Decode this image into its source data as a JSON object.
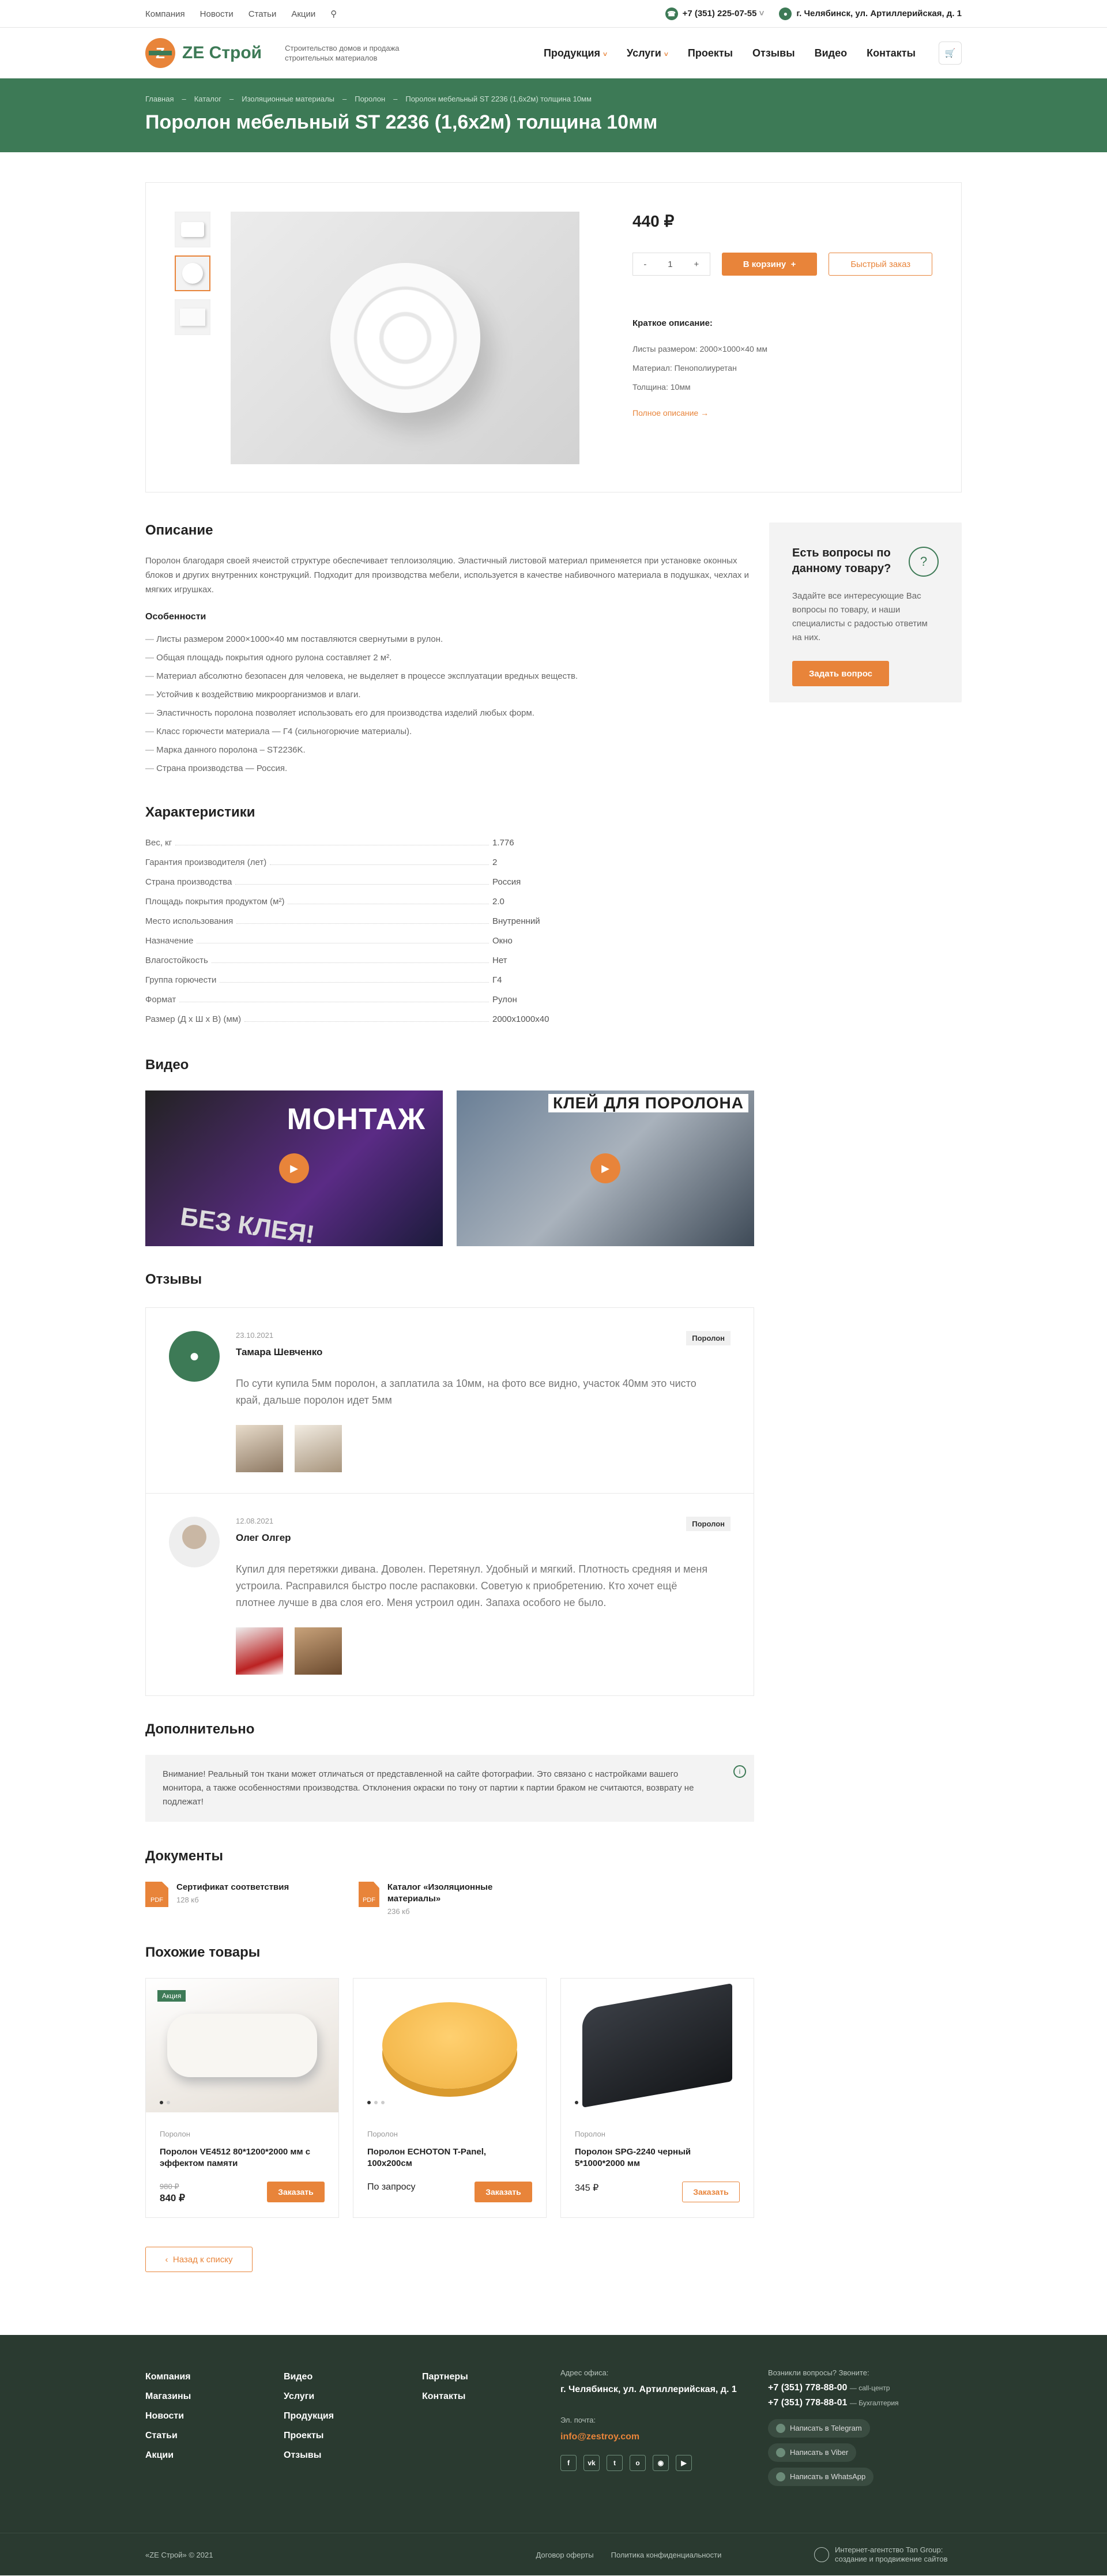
{
  "topbar": {
    "links": [
      "Компания",
      "Новости",
      "Статьи",
      "Акции"
    ],
    "phone": "+7 (351) 225-07-55",
    "address": "г. Челябинск, ул. Артиллерийская, д. 1"
  },
  "header": {
    "logo_text": "ZE Строй",
    "tagline": "Строительство домов и продажа строительных материалов",
    "nav": [
      "Продукция",
      "Услуги",
      "Проекты",
      "Отзывы",
      "Видео",
      "Контакты"
    ]
  },
  "hero": {
    "crumbs": [
      "Главная",
      "Каталог",
      "Изоляционные материалы",
      "Поролон",
      "Поролон мебельный ST 2236 (1,6х2м) толщина 10мм"
    ],
    "title": "Поролон мебельный ST 2236 (1,6х2м) толщина 10мм"
  },
  "product": {
    "price": "440 ₽",
    "qty": "1",
    "cart_btn": "В корзину",
    "quick_btn": "Быстрый заказ",
    "short_title": "Краткое описание:",
    "short_items": [
      "Листы размером: 2000×1000×40 мм",
      "Материал: Пенополиуретан",
      "Толщина: 10мм"
    ],
    "more_link": "Полное описание"
  },
  "description": {
    "title": "Описание",
    "text": "Поролон благодаря своей ячеистой структуре обеспечивает теплоизоляцию. Эластичный листовой материал применяется при установке оконных блоков и других внутренних конструкций. Подходит для производства мебели, используется в качестве набивочного материала в подушках, чехлах и мягких игрушках.",
    "features_title": "Особенности",
    "features": [
      "Листы размером 2000×1000×40 мм поставляются свернутыми в рулон.",
      "Общая площадь покрытия одного рулона составляет 2 м².",
      "Материал абсолютно безопасен для человека, не выделяет в процессе эксплуатации вредных веществ.",
      "Устойчив к воздействию микроорганизмов и влаги.",
      "Эластичность поролона позволяет использовать его для производства изделий любых форм.",
      "Класс горючести материала — Г4 (сильногорючие материалы).",
      "Марка данного поролона – ST2236K.",
      "Страна производства — Россия."
    ]
  },
  "question": {
    "title": "Есть вопросы по данному товару?",
    "text": "Задайте все интересующие Вас вопросы по товару, и наши специалисты с радостью ответим на них.",
    "button": "Задать вопрос"
  },
  "chars": {
    "title": "Характеристики",
    "rows": [
      [
        "Вес, кг",
        "1.776"
      ],
      [
        "Гарантия производителя (лет)",
        "2"
      ],
      [
        "Страна производства",
        "Россия"
      ],
      [
        "Площадь покрытия продуктом (м²)",
        "2.0"
      ],
      [
        "Место использования",
        "Внутренний"
      ],
      [
        "Назначение",
        "Окно"
      ],
      [
        "Влагостойкость",
        "Нет"
      ],
      [
        "Группа горючести",
        "Г4"
      ],
      [
        "Формат",
        "Рулон"
      ],
      [
        "Размер (Д х Ш х В) (мм)",
        "2000х1000х40"
      ]
    ]
  },
  "video": {
    "title": "Видео",
    "items": [
      {
        "caption": "МОНТАЖ",
        "sub": "БЕЗ КЛЕЯ!"
      },
      {
        "caption": "КЛЕЙ ДЛЯ ПОРОЛОНА",
        "sub": ""
      }
    ]
  },
  "reviews": {
    "title": "Отзывы",
    "items": [
      {
        "date": "23.10.2021",
        "name": "Тамара Шевченко",
        "tag": "Поролон",
        "text": "По сути купила 5мм поролон, а заплатила за 10мм, на фото все видно, участок 40мм это чисто край, дальше поролон идет 5мм"
      },
      {
        "date": "12.08.2021",
        "name": "Олег Олгер",
        "tag": "Поролон",
        "text": "Купил для перетяжки дивана. Доволен. Перетянул. Удобный и мягкий. Плотность средняя и меня устроила. Расправился быстро после распаковки. Советую к приобретению. Кто хочет ещё плотнее лучше в два слоя его. Меня устроил один. Запаха особого не было."
      }
    ]
  },
  "extra": {
    "title": "Дополнительно",
    "notice": "Внимание! Реальный тон ткани может отличаться от представленной на сайте фотографии. Это связано с настройками вашего монитора, а также особенностями производства. Отклонения окраски по тону от партии к партии браком не считаются, возврату не подлежат!"
  },
  "docs": {
    "title": "Документы",
    "items": [
      {
        "name": "Сертификат соответствия",
        "size": "128 кб",
        "ext": "PDF"
      },
      {
        "name": "Каталог «Изоляционные материалы»",
        "size": "236 кб",
        "ext": "PDF"
      }
    ]
  },
  "similar": {
    "title": "Похожие товары",
    "items": [
      {
        "badge": "Акция",
        "cat": "Поролон",
        "name": "Поролон VE4512 80*1200*2000 мм с эффектом памяти",
        "old": "980 ₽",
        "price": "840 ₽",
        "btn": "Заказать"
      },
      {
        "badge": "",
        "cat": "Поролон",
        "name": "Поролон ECHOTON T-Panel, 100х200см",
        "old": "",
        "price": "По запросу",
        "btn": "Заказать"
      },
      {
        "badge": "",
        "cat": "Поролон",
        "name": "Поролон SPG-2240 черный 5*1000*2000 мм",
        "old": "",
        "price": "345 ₽",
        "btn": "Заказать"
      }
    ],
    "back": "Назад к списку"
  },
  "footer": {
    "col1": [
      "Компания",
      "Магазины",
      "Новости",
      "Статьи",
      "Акции"
    ],
    "col2": [
      "Видео",
      "Услуги",
      "Продукция",
      "Проекты",
      "Отзывы"
    ],
    "col3": [
      "Партнеры",
      "Контакты"
    ],
    "addr_label": "Адрес офиса:",
    "addr": "г. Челябинск, ул. Артиллерийская, д. 1",
    "mail_label": "Эл. почта:",
    "mail": "info@zestroy.com",
    "q_label": "Возникли вопросы? Звоните:",
    "phone1": "+7 (351) 778-88-00",
    "phone1_note": "— call-центр",
    "phone2": "+7 (351) 778-88-01",
    "phone2_note": "— Бухгалтерия",
    "msg": [
      "Написать в Telegram",
      "Написать в Viber",
      "Написать в WhatsApp"
    ],
    "socials": [
      "f",
      "vk",
      "tw",
      "ok",
      "ig",
      "yt"
    ],
    "copy": "«ZE Строй» © 2021",
    "links": [
      "Договор оферты",
      "Политика конфиденциальности"
    ],
    "dev": "Интернет-агентство Tan Group: создание и продвижение сайтов"
  },
  "colors": {
    "brand_green": "#3d7a56",
    "accent_orange": "#e8843a",
    "footer_bg": "#2a3a30"
  }
}
